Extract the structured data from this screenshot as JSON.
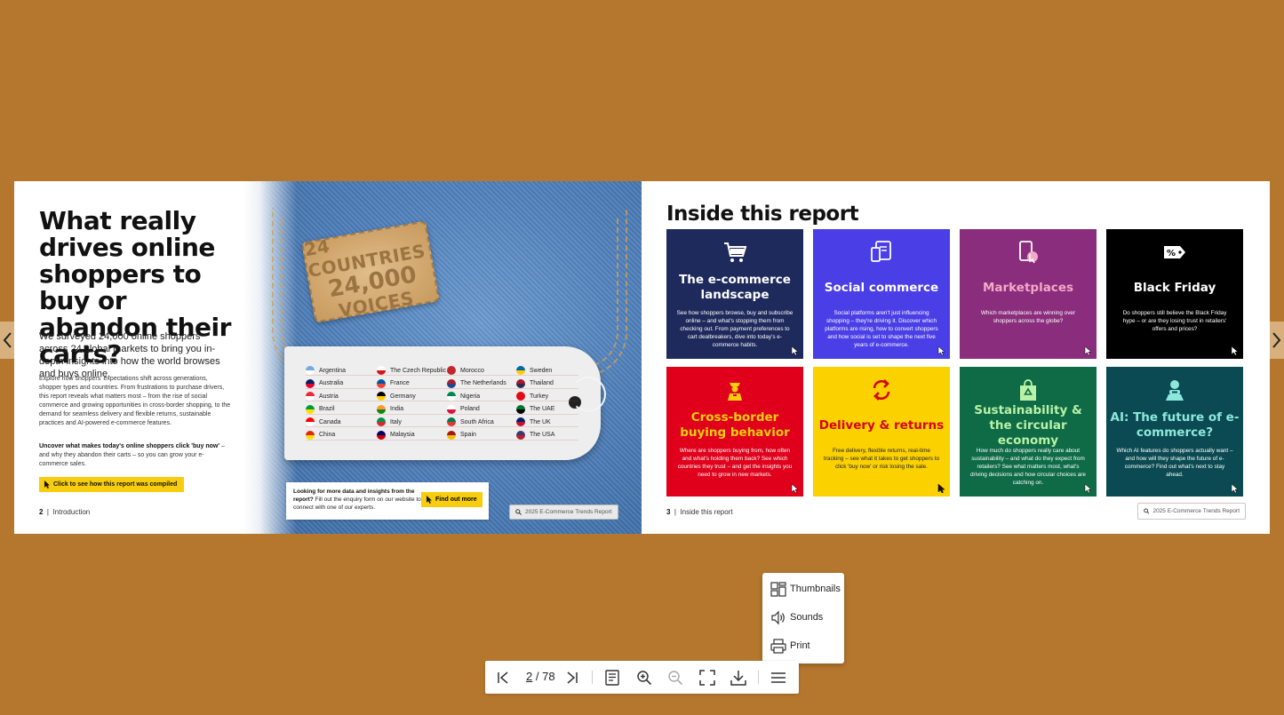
{
  "left_page": {
    "title": "What really drives online shoppers to buy or abandon their carts?",
    "lead": "We surveyed 24,000 online shoppers across 24 global markets to bring you in-depth insights into how the world browses and buys online.",
    "body": "Explore how shoppers' expectations shift across generations, shopper types and countries. From frustrations to purchase drivers, this report reveals what matters most – from the rise of social commerce and growing opportunities in cross-border shopping, to the demand for seamless delivery and flexible returns, sustainable practices and AI-powered e-commerce features.",
    "body2_bold": "Uncover what makes today's online shoppers click 'buy now'",
    "body2_rest": " – and why they abandon their carts – so you can grow your e-commerce sales.",
    "cta_label": "Click to see how this report was compiled",
    "page_number": "2",
    "page_section": "Introduction",
    "patch_line1": "24 COUNTRIES",
    "patch_line2": "24,000",
    "patch_line3": "VOICES",
    "countries": [
      {
        "name": "Argentina",
        "colors": [
          "#75aadb",
          "#ffffff"
        ]
      },
      {
        "name": "The Czech Republic",
        "colors": [
          "#ffffff",
          "#d7141a"
        ]
      },
      {
        "name": "Morocco",
        "colors": [
          "#c1272d",
          "#c1272d"
        ]
      },
      {
        "name": "Sweden",
        "colors": [
          "#006aa7",
          "#fecc00"
        ]
      },
      {
        "name": "Australia",
        "colors": [
          "#012169",
          "#e4002b"
        ]
      },
      {
        "name": "France",
        "colors": [
          "#0055a4",
          "#ef4135"
        ]
      },
      {
        "name": "The Netherlands",
        "colors": [
          "#ae1c28",
          "#21468b"
        ]
      },
      {
        "name": "Thailand",
        "colors": [
          "#a51931",
          "#2d2a4a"
        ]
      },
      {
        "name": "Austria",
        "colors": [
          "#ed2939",
          "#ffffff"
        ]
      },
      {
        "name": "Germany",
        "colors": [
          "#000000",
          "#ffce00"
        ]
      },
      {
        "name": "Nigeria",
        "colors": [
          "#008751",
          "#ffffff"
        ]
      },
      {
        "name": "Turkey",
        "colors": [
          "#e30a17",
          "#e30a17"
        ]
      },
      {
        "name": "Brazil",
        "colors": [
          "#009c3b",
          "#ffdf00"
        ]
      },
      {
        "name": "India",
        "colors": [
          "#ff9933",
          "#138808"
        ]
      },
      {
        "name": "Poland",
        "colors": [
          "#ffffff",
          "#dc143c"
        ]
      },
      {
        "name": "The UAE",
        "colors": [
          "#00732f",
          "#000000"
        ]
      },
      {
        "name": "Canada",
        "colors": [
          "#ff0000",
          "#ffffff"
        ]
      },
      {
        "name": "Italy",
        "colors": [
          "#009246",
          "#ce2b37"
        ]
      },
      {
        "name": "South Africa",
        "colors": [
          "#007a4d",
          "#de3831"
        ]
      },
      {
        "name": "The UK",
        "colors": [
          "#012169",
          "#c8102e"
        ]
      },
      {
        "name": "China",
        "colors": [
          "#de2910",
          "#ffde00"
        ]
      },
      {
        "name": "Malaysia",
        "colors": [
          "#010066",
          "#cc0001"
        ]
      },
      {
        "name": "Spain",
        "colors": [
          "#aa151b",
          "#f1bf00"
        ]
      },
      {
        "name": "The USA",
        "colors": [
          "#3c3b6e",
          "#b22234"
        ]
      }
    ],
    "enquiry_bold": "Looking for more data and insights from the report?",
    "enquiry_rest": " Fill out the enquiry form on our website to connect with one of our experts.",
    "find_out_label": "Find out more",
    "search_chip": "2025 E-Commerce Trends Report"
  },
  "right_page": {
    "title": "Inside this report",
    "page_number": "3",
    "page_section": "Inside this report",
    "search_chip": "2025 E-Commerce Trends Report",
    "tiles": [
      {
        "title": "The e-commerce landscape",
        "desc": "See how shoppers browse, buy and subscribe online – and what's stopping them from checking out. From payment preferences to cart dealbreakers, dive into today's e-commerce habits.",
        "bg": "#1f2a5c",
        "title_color": "#ffffff",
        "icon": "cart-icon"
      },
      {
        "title": "Social commerce",
        "desc": "Social platforms aren't just influencing shopping – they're driving it. Discover which platforms are rising, how to convert shoppers and how social is set to shape the next five years of e-commerce.",
        "bg": "#4a3ee6",
        "title_color": "#ffffff",
        "icon": "devices-icon"
      },
      {
        "title": "Marketplaces",
        "desc": "Which marketplaces are winning over shoppers across the globe?",
        "bg": "#8a2d7d",
        "title_color": "#f4a9c7",
        "icon": "phone-tap-icon"
      },
      {
        "title": "Black Friday",
        "desc": "Do shoppers still believe the Black Friday hype – or are they losing trust in retailers' offers and prices?",
        "bg": "#000000",
        "title_color": "#ffffff",
        "icon": "percent-tag-icon"
      },
      {
        "title": "Cross-border buying behavior",
        "desc": "Where are shoppers buying from, how often and what's holding them back? See which countries they trust – and get the insights you need to grow in new markets.",
        "bg": "#e0001b",
        "title_color": "#f7cd0d",
        "icon": "customs-officer-icon"
      },
      {
        "title": "Delivery & returns",
        "desc": "Free delivery, flexible returns, real-time tracking – see what it takes to get shoppers to click 'buy now' or risk losing the sale.",
        "bg": "#fcd100",
        "title_color": "#d40511",
        "icon": "return-arrows-icon"
      },
      {
        "title": "Sustainability & the circular economy",
        "desc": "How much do shoppers really care about sustainability – and what do they expect from retailers? See what matters most, what's driving decisions and how circular choices are catching on.",
        "bg": "#0e6b46",
        "title_color": "#b9f2a6",
        "icon": "recycle-bag-icon"
      },
      {
        "title": "AI: The future of e-commerce?",
        "desc": "Which AI features do shoppers actually want – and how will they shape the future of e-commerce? Find out what's next to stay ahead.",
        "bg": "#0b4a52",
        "title_color": "#8de8dc",
        "icon": "robot-icon"
      }
    ]
  },
  "toolbar": {
    "current_page": "2",
    "page_separator": "/",
    "total_pages": "78"
  },
  "menu": {
    "items": [
      "Thumbnails",
      "Sounds",
      "Print"
    ]
  }
}
